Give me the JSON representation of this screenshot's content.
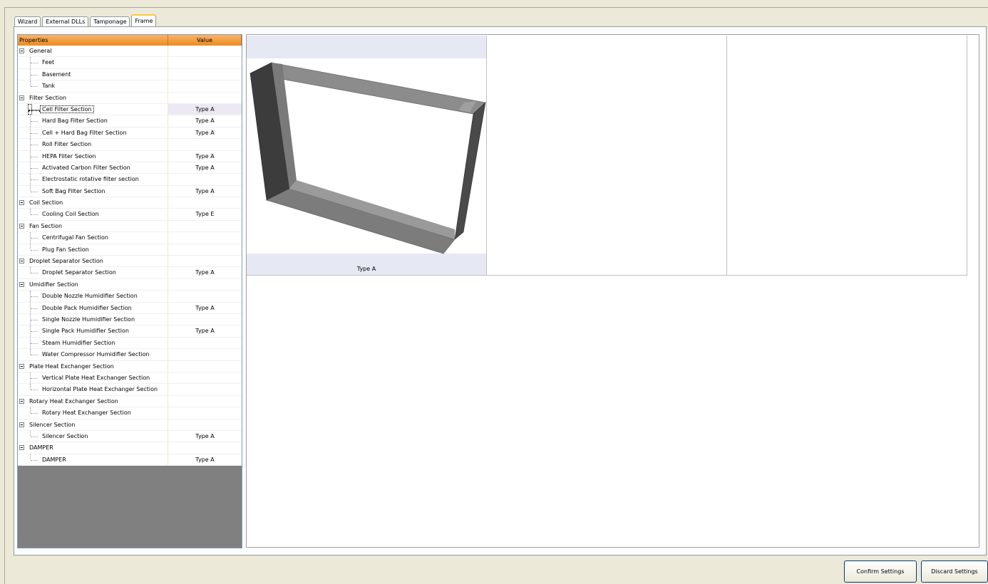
{
  "tabs": [
    {
      "label": "Wizard"
    },
    {
      "label": "External DLLs"
    },
    {
      "label": "Tamponage"
    },
    {
      "label": "Frame",
      "active": true
    }
  ],
  "grid": {
    "header_property": "Properties",
    "header_value": "Value",
    "colors": {
      "header": "#f59b3f",
      "empty_area": "#808080"
    },
    "rows": [
      {
        "label": "General",
        "value": "",
        "kind": "group"
      },
      {
        "label": "Feet",
        "value": "",
        "kind": "child"
      },
      {
        "label": "Basement",
        "value": "",
        "kind": "child"
      },
      {
        "label": "Tank",
        "value": "",
        "kind": "child"
      },
      {
        "label": "Filter Section",
        "value": "",
        "kind": "group"
      },
      {
        "label": "Cell Filter Section",
        "value": "Type A",
        "kind": "child",
        "selected": true
      },
      {
        "label": "Hard Bag Filter Section",
        "value": "Type A",
        "kind": "child"
      },
      {
        "label": "Cell + Hard Bag Filter Section",
        "value": "Type A",
        "kind": "child"
      },
      {
        "label": "Roll Filter Section",
        "value": "",
        "kind": "child"
      },
      {
        "label": "HEPA Filter Section",
        "value": "Type A",
        "kind": "child"
      },
      {
        "label": "Activated Carbon Filter Section",
        "value": "Type A",
        "kind": "child"
      },
      {
        "label": "Electrostatic rotative filter section",
        "value": "",
        "kind": "child"
      },
      {
        "label": "Soft Bag Filter Section",
        "value": "Type A",
        "kind": "child"
      },
      {
        "label": "Coil Section",
        "value": "",
        "kind": "group"
      },
      {
        "label": "Cooling Coil Section",
        "value": "Type E",
        "kind": "child"
      },
      {
        "label": "Fan Section",
        "value": "",
        "kind": "group"
      },
      {
        "label": "Centrifugal Fan Section",
        "value": "",
        "kind": "child"
      },
      {
        "label": "Plug Fan Section",
        "value": "",
        "kind": "child"
      },
      {
        "label": "Droplet Separator Section",
        "value": "",
        "kind": "group"
      },
      {
        "label": "Droplet Separator Section",
        "value": "Type A",
        "kind": "child"
      },
      {
        "label": "Umidifier Section",
        "value": "",
        "kind": "group"
      },
      {
        "label": "Double Nozzle Humidifier Section",
        "value": "",
        "kind": "child"
      },
      {
        "label": "Double Pack Humidifier Section",
        "value": "Type A",
        "kind": "child"
      },
      {
        "label": "Single Nozzle Humidifier Section",
        "value": "",
        "kind": "child"
      },
      {
        "label": "Single Pack Humidifier Section",
        "value": "Type A",
        "kind": "child"
      },
      {
        "label": "Steam Humidifier Section",
        "value": "",
        "kind": "child"
      },
      {
        "label": "Water Compressor Humidifier Section",
        "value": "",
        "kind": "child"
      },
      {
        "label": "Plate Heat Exchanger Section",
        "value": "",
        "kind": "group"
      },
      {
        "label": "Vertical Plate Heat Exchanger Section",
        "value": "",
        "kind": "child"
      },
      {
        "label": "Horizontal Plate Heat Exchanger Section",
        "value": "",
        "kind": "child"
      },
      {
        "label": "Rotary Heat Exchanger Section",
        "value": "",
        "kind": "group"
      },
      {
        "label": "Rotary Heat Exchanger Section",
        "value": "",
        "kind": "child"
      },
      {
        "label": "Silencer Section",
        "value": "",
        "kind": "group"
      },
      {
        "label": "Silencer Section",
        "value": "Type A",
        "kind": "child"
      },
      {
        "label": "DAMPER",
        "value": "",
        "kind": "group"
      },
      {
        "label": "DAMPER",
        "value": "Type A",
        "kind": "child"
      }
    ]
  },
  "preview": {
    "tiles": [
      {
        "caption": "Type A",
        "image": "frame-3d-icon"
      },
      {
        "caption": ""
      },
      {
        "caption": ""
      }
    ]
  },
  "buttons": {
    "confirm_label": "Confirm Settings",
    "discard_label": "Discard Settings"
  }
}
